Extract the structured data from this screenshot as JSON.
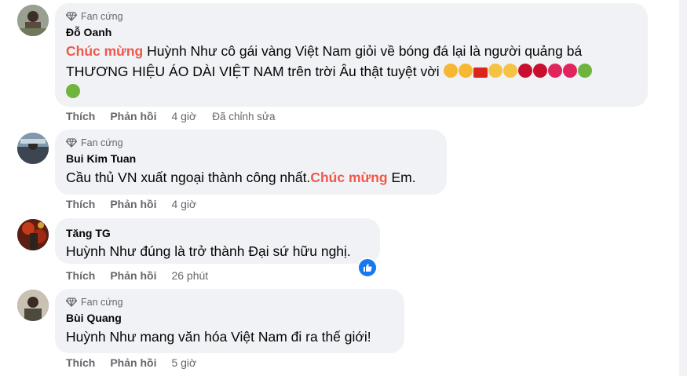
{
  "colors": {
    "accent": "#f0584a",
    "bubble": "#f0f2f5",
    "secondary_text": "#65676b",
    "like_blue": "#1877f2"
  },
  "comments": [
    {
      "badge": "Fan cứng",
      "author": "Đỗ Oanh",
      "highlight": "Chúc mừng",
      "text": " Huỳnh Như cô gái vàng Việt Nam giỏi về bóng đá lại là người quảng bá THƯƠNG HIỆU ÁO DÀI VIỆT NAM trên trời Âu thật tuyệt vời",
      "emoji": [
        "smiling-face-with-hearts",
        "smiling-face-with-hearts",
        "vietnam-flag",
        "clapping-hands",
        "clapping-hands",
        "rose",
        "rose",
        "red-heart",
        "red-heart",
        "herb",
        "herb"
      ],
      "like": "Thích",
      "reply": "Phản hồi",
      "time": "4 giờ",
      "edited": "Đã chỉnh sửa"
    },
    {
      "badge": "Fan cứng",
      "author": "Bui Kim Tuan",
      "text_before": "Cầu thủ VN xuất ngoại thành công nhất.",
      "highlight": "Chúc mừng",
      "text_after": " Em.",
      "like": "Thích",
      "reply": "Phản hồi",
      "time": "4 giờ"
    },
    {
      "author": "Tăng TG",
      "text": "Huỳnh Như đúng là trở thành Đại sứ hữu nghị.",
      "reactions": [
        "like"
      ],
      "like": "Thích",
      "reply": "Phản hồi",
      "time": "26 phút"
    },
    {
      "badge": "Fan cứng",
      "author": "Bùi Quang",
      "text": "Huỳnh Như mang văn hóa Việt Nam đi ra thế giới!",
      "like": "Thích",
      "reply": "Phản hồi",
      "time": "5 giờ"
    }
  ]
}
